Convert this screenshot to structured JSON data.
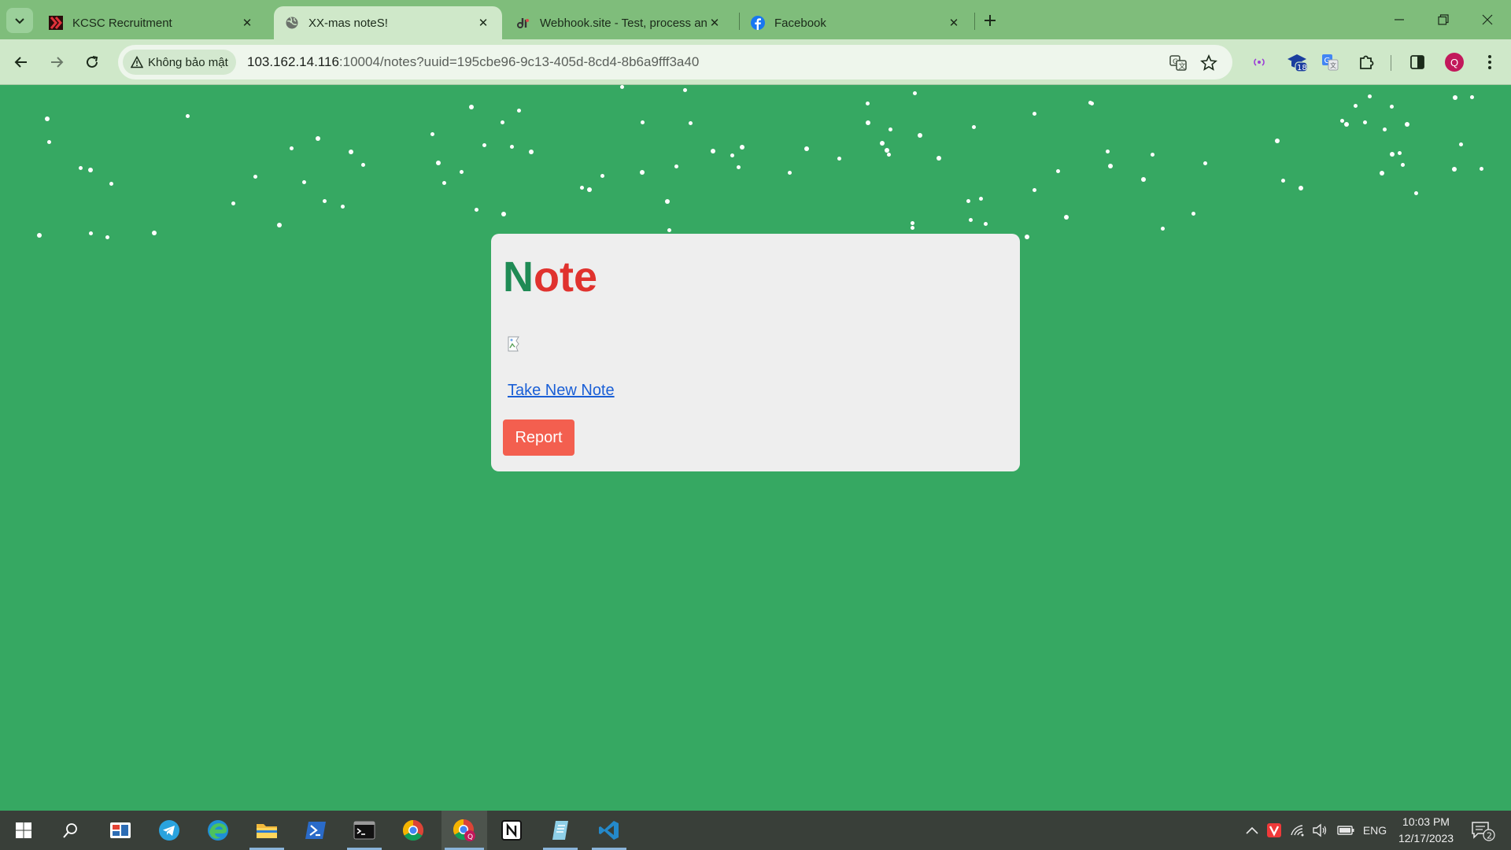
{
  "browser": {
    "tabs": [
      {
        "title": "KCSC Recruitment",
        "favicon": "kcsc-logo-icon"
      },
      {
        "title": "XX-mas noteS!",
        "favicon": "globe-icon",
        "active": true
      },
      {
        "title": "Webhook.site - Test, process an",
        "favicon": "webhook-icon"
      },
      {
        "title": "Facebook",
        "favicon": "facebook-icon"
      }
    ],
    "security_label": "Không bảo mật",
    "url_host": "103.162.14.116",
    "url_rest": ":10004/notes?uuid=195cbe96-9c13-405d-8cd4-8b6a9fff3a40",
    "extension_badge": "18",
    "profile_initial": "Q"
  },
  "note_page": {
    "title_part1": "N",
    "title_part2": "o",
    "title_part3": "t",
    "title_part4": "e",
    "image_alt": "",
    "new_note_link": "Take New Note",
    "report_button": "Report",
    "colors": {
      "background": "#36a862",
      "title_green": "#1f8b55",
      "title_red": "#e0322e",
      "report": "#f35f4f"
    }
  },
  "taskbar": {
    "language": "ENG",
    "time": "10:03 PM",
    "date": "12/17/2023",
    "notification_count": "2"
  }
}
